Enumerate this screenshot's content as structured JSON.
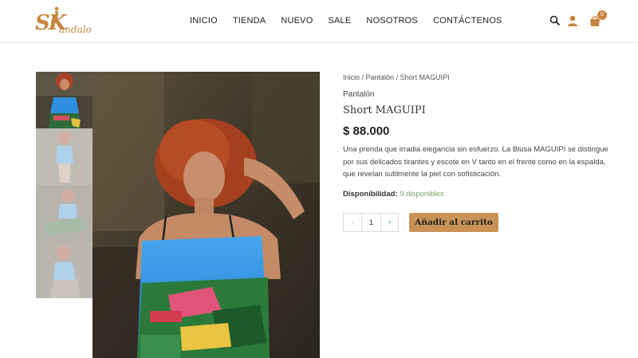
{
  "brand": {
    "logo_text_main": "SK",
    "logo_text_rest": "andalo",
    "accent": "#c8873f"
  },
  "nav": {
    "items": [
      {
        "label": "INICIO"
      },
      {
        "label": "TIENDA"
      },
      {
        "label": "NUEVO"
      },
      {
        "label": "SALE"
      },
      {
        "label": "NOSOTROS"
      },
      {
        "label": "CONTÁCTENOS"
      }
    ]
  },
  "header_icons": {
    "search": "search-icon",
    "account": "user-icon",
    "cart": "shopping-bag-icon",
    "cart_count": "0"
  },
  "gallery": {
    "thumbnail_count": 4,
    "active_thumbnail": 1
  },
  "product": {
    "breadcrumb": [
      "Inicio",
      "Pantalón",
      "Short MAGUIPI"
    ],
    "breadcrumb_sep": " / ",
    "category": "Pantalón",
    "title": "Short MAGUIPI",
    "price": "$ 88.000",
    "description": "Una prenda que irradia elegancia sin esfuerzo. La Blusa MAGUIPI se distingue por sus delicados tirantes y escote en V tanto en el frente como en la espalda, que revelan sutilmente la piel con sofisticación.",
    "availability_label": "Disponibilidad:",
    "availability_value": "9 disponibles",
    "quantity": "1",
    "qty_minus": "-",
    "qty_plus": "+",
    "add_to_cart": "Añadir al carrito"
  },
  "colors": {
    "button": "#c99258",
    "stock": "#77a464",
    "badge": "#c8873f"
  }
}
